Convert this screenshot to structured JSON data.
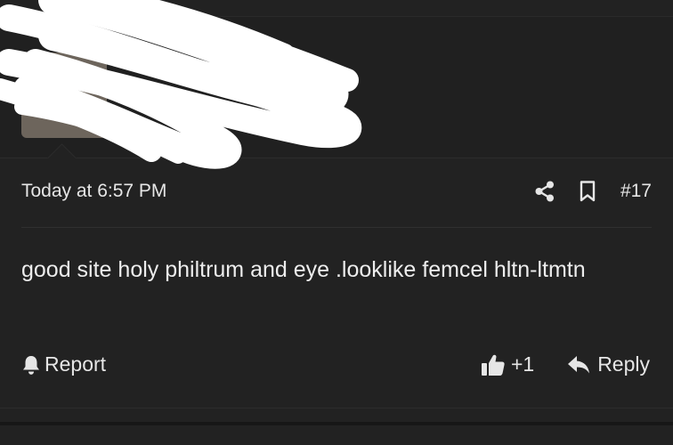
{
  "post": {
    "timestamp": "Today at 6:57 PM",
    "post_number": "#17",
    "message": "good site holy philtrum and eye .looklike femcel hltn-ltmtn",
    "report_label": "Report",
    "like_count": "+1",
    "reply_label": "Reply"
  },
  "icons": {
    "share": "share-icon",
    "bookmark": "bookmark-icon",
    "bell": "bell-icon",
    "thumbs_up": "thumbs-up-icon",
    "reply": "reply-arrow-icon"
  },
  "colors": {
    "background": "#171717",
    "card": "#222222",
    "text": "#e6e6e6"
  }
}
